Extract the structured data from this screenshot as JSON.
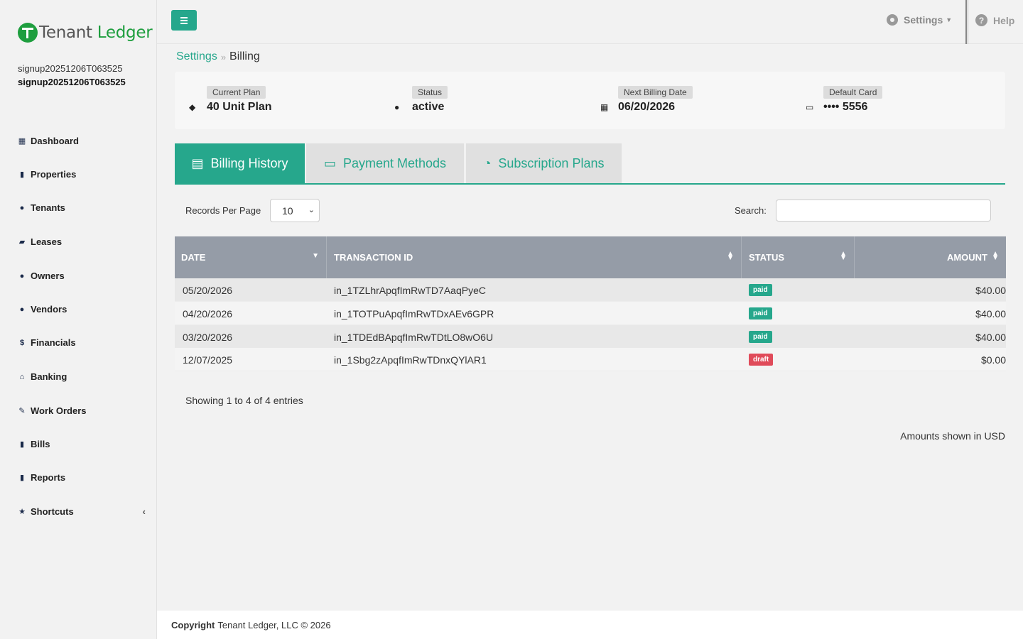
{
  "brand": {
    "name_part1": "Tenant",
    "name_part2": "Ledger"
  },
  "user": {
    "line1": "signup20251206T063525",
    "line2": "signup20251206T063525"
  },
  "sidebar": {
    "items": [
      {
        "label": "Dashboard",
        "icon": "dashboard-icon"
      },
      {
        "label": "Properties",
        "icon": "building-icon"
      },
      {
        "label": "Tenants",
        "icon": "user-icon"
      },
      {
        "label": "Leases",
        "icon": "folder-icon"
      },
      {
        "label": "Owners",
        "icon": "users-icon"
      },
      {
        "label": "Vendors",
        "icon": "users-icon"
      },
      {
        "label": "Financials",
        "icon": "dollar-icon"
      },
      {
        "label": "Banking",
        "icon": "bank-icon"
      },
      {
        "label": "Work Orders",
        "icon": "edit-icon"
      },
      {
        "label": "Bills",
        "icon": "file-icon"
      },
      {
        "label": "Reports",
        "icon": "report-icon"
      },
      {
        "label": "Shortcuts",
        "icon": "star-icon"
      }
    ]
  },
  "topbar": {
    "settings_label": "Settings",
    "help_label": "Help"
  },
  "breadcrumb": {
    "parent": "Settings",
    "current": "Billing"
  },
  "summary": {
    "current_plan": {
      "label": "Current Plan",
      "value": "40 Unit Plan"
    },
    "status": {
      "label": "Status",
      "value": "active"
    },
    "next_billing": {
      "label": "Next Billing Date",
      "value": "06/20/2026"
    },
    "default_card": {
      "label": "Default Card",
      "value": "•••• 5556"
    }
  },
  "tabs": [
    {
      "label": "Billing History",
      "active": true
    },
    {
      "label": "Payment Methods",
      "active": false
    },
    {
      "label": "Subscription Plans",
      "active": false
    }
  ],
  "controls": {
    "records_per_page_label": "Records Per Page",
    "records_per_page_value": "10",
    "search_label": "Search:",
    "search_value": ""
  },
  "table": {
    "columns": [
      "DATE",
      "TRANSACTION ID",
      "STATUS",
      "AMOUNT"
    ],
    "rows": [
      {
        "date": "05/20/2026",
        "txn": "in_1TZLhrApqfImRwTD7AaqPyeC",
        "status": "paid",
        "amount": "$40.00"
      },
      {
        "date": "04/20/2026",
        "txn": "in_1TOTPuApqfImRwTDxAEv6GPR",
        "status": "paid",
        "amount": "$40.00"
      },
      {
        "date": "03/20/2026",
        "txn": "in_1TDEdBApqfImRwTDtLO8wO6U",
        "status": "paid",
        "amount": "$40.00"
      },
      {
        "date": "12/07/2025",
        "txn": "in_1Sbg2zApqfImRwTDnxQYlAR1",
        "status": "draft",
        "amount": "$0.00"
      }
    ]
  },
  "footer_info": {
    "showing": "Showing 1 to 4 of 4 entries",
    "currency_note": "Amounts shown in USD"
  },
  "footer": {
    "copyright_label": "Copyright",
    "copyright_text": "Tenant Ledger, LLC © 2026"
  },
  "colors": {
    "accent": "#26a78c",
    "paid": "#26a78c",
    "draft": "#e04b5a",
    "table_header": "#959ca7",
    "brand_green": "#1e9e3e"
  }
}
